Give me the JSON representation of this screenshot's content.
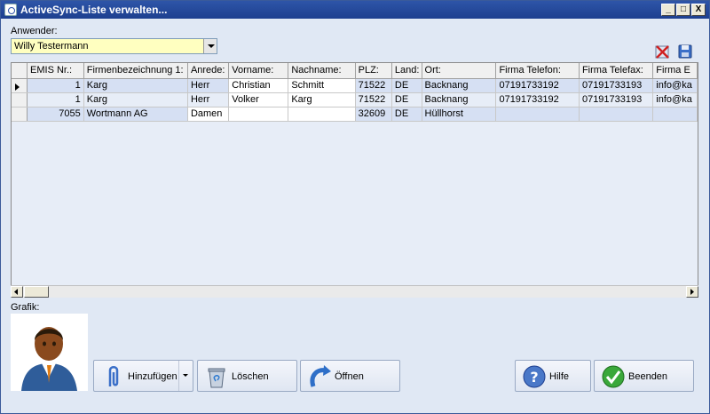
{
  "window": {
    "title": "ActiveSync-Liste verwalten..."
  },
  "titlebar_buttons": {
    "minimize": "_",
    "maximize": "□",
    "close": "X"
  },
  "user_label": "Anwender:",
  "user_select": {
    "value": "Willy Testermann"
  },
  "grafik_label": "Grafik:",
  "table": {
    "columns": [
      "EMIS Nr.:",
      "Firmenbezeichnung 1:",
      "Anrede:",
      "Vorname:",
      "Nachname:",
      "PLZ:",
      "Land:",
      "Ort:",
      "Firma Telefon:",
      "Firma Telefax:",
      "Firma E"
    ],
    "rows": [
      [
        "1",
        "Karg",
        "Herr",
        "Christian",
        "Schmitt",
        "71522",
        "DE",
        "Backnang",
        "07191733192",
        "07191733193",
        "info@ka"
      ],
      [
        "1",
        "Karg",
        "Herr",
        "Volker",
        "Karg",
        "71522",
        "DE",
        "Backnang",
        "07191733192",
        "07191733193",
        "info@ka"
      ],
      [
        "7055",
        "Wortmann AG",
        "Damen",
        "",
        "",
        "32609",
        "DE",
        "Hüllhorst",
        "",
        "",
        ""
      ]
    ],
    "selected_row": 0
  },
  "buttons": {
    "add": "Hinzufügen",
    "delete": "Löschen",
    "open": "Öffnen",
    "help": "Hilfe",
    "exit": "Beenden"
  },
  "colors": {
    "title_bar": "#1d3f8f",
    "window_bg": "#e0e8f4",
    "combo_bg": "#ffffc0",
    "row_alt": "#d6e0f3"
  }
}
